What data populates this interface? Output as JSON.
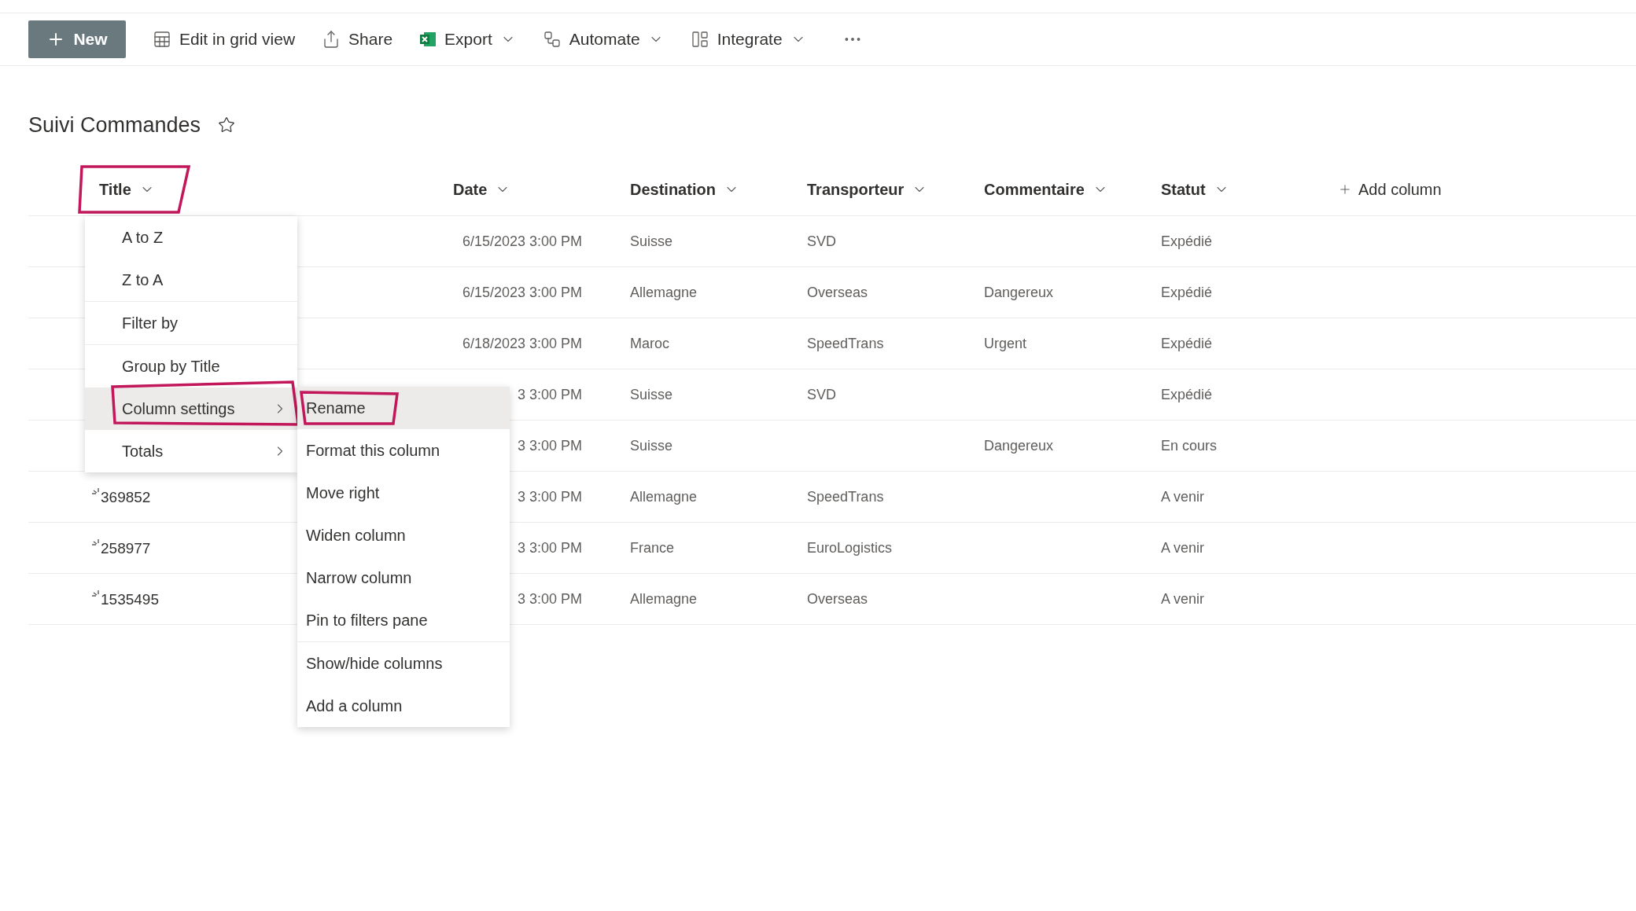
{
  "toolbar": {
    "new_button": "New",
    "items": [
      {
        "label": "Edit in grid view",
        "kind": "grid",
        "dropdown": false
      },
      {
        "label": "Share",
        "kind": "share",
        "dropdown": false
      },
      {
        "label": "Export",
        "kind": "excel",
        "dropdown": true
      },
      {
        "label": "Automate",
        "kind": "automate",
        "dropdown": true
      },
      {
        "label": "Integrate",
        "kind": "integrate",
        "dropdown": true
      }
    ]
  },
  "list_title": "Suivi Commandes",
  "favorite": false,
  "table": {
    "columns": [
      {
        "label": "Title",
        "highlighted": true
      },
      {
        "label": "Date",
        "highlighted": false
      },
      {
        "label": "Destination",
        "highlighted": false
      },
      {
        "label": "Transporteur",
        "highlighted": false
      },
      {
        "label": "Commentaire",
        "highlighted": false
      },
      {
        "label": "Statut",
        "highlighted": false
      }
    ],
    "add_column": "Add column",
    "rows": [
      {
        "date": "6/15/2023 3:00 PM",
        "destination": "Suisse",
        "transporteur": "SVD",
        "statut": "Expédié"
      },
      {
        "date": "6/15/2023 3:00 PM",
        "destination": "Allemagne",
        "transporteur": "Overseas",
        "commentaire": "Dangereux",
        "statut": "Expédié"
      },
      {
        "date": "6/18/2023 3:00 PM",
        "destination": "Maroc",
        "transporteur": "SpeedTrans",
        "commentaire": "Urgent",
        "statut": "Expédié"
      },
      {
        "date": "3 3:00 PM",
        "destination": "Suisse",
        "transporteur": "SVD",
        "statut": "Expédié"
      },
      {
        "date": "3 3:00 PM",
        "destination": "Suisse",
        "commentaire": "Dangereux",
        "statut": "En cours"
      },
      {
        "title": "369852",
        "new": true,
        "date": "3 3:00 PM",
        "destination": "Allemagne",
        "transporteur": "SpeedTrans",
        "statut": "A venir"
      },
      {
        "title": "258977",
        "new": true,
        "date": "3 3:00 PM",
        "destination": "France",
        "transporteur": "EuroLogistics",
        "statut": "A venir"
      },
      {
        "title": "1535495",
        "new": true,
        "date": "3 3:00 PM",
        "destination": "Allemagne",
        "transporteur": "Overseas",
        "statut": "A venir"
      }
    ]
  },
  "column_menu": {
    "sections": [
      [
        {
          "label": "A to Z",
          "selected": false,
          "submenu": false,
          "highlighted": false
        },
        {
          "label": "Z to A",
          "selected": false,
          "submenu": false,
          "highlighted": false
        }
      ],
      [
        {
          "label": "Filter by",
          "selected": false,
          "submenu": false,
          "highlighted": false
        }
      ],
      [
        {
          "label": "Group by Title",
          "selected": false,
          "submenu": false,
          "highlighted": false
        },
        {
          "label": "Column settings",
          "selected": true,
          "submenu": true,
          "highlighted": true
        },
        {
          "label": "Totals",
          "selected": false,
          "submenu": true,
          "highlighted": false
        }
      ]
    ]
  },
  "submenu": {
    "sections": [
      [
        {
          "label": "Rename",
          "selected": true,
          "highlighted": true
        },
        {
          "label": "Format this column",
          "selected": false,
          "highlighted": false
        },
        {
          "label": "Move right",
          "selected": false,
          "highlighted": false
        },
        {
          "label": "Widen column",
          "selected": false,
          "highlighted": false
        },
        {
          "label": "Narrow column",
          "selected": false,
          "highlighted": false
        },
        {
          "label": "Pin to filters pane",
          "selected": false,
          "highlighted": false
        }
      ],
      [
        {
          "label": "Show/hide columns",
          "selected": false,
          "highlighted": false
        },
        {
          "label": "Add a column",
          "selected": false,
          "highlighted": false
        }
      ]
    ]
  }
}
